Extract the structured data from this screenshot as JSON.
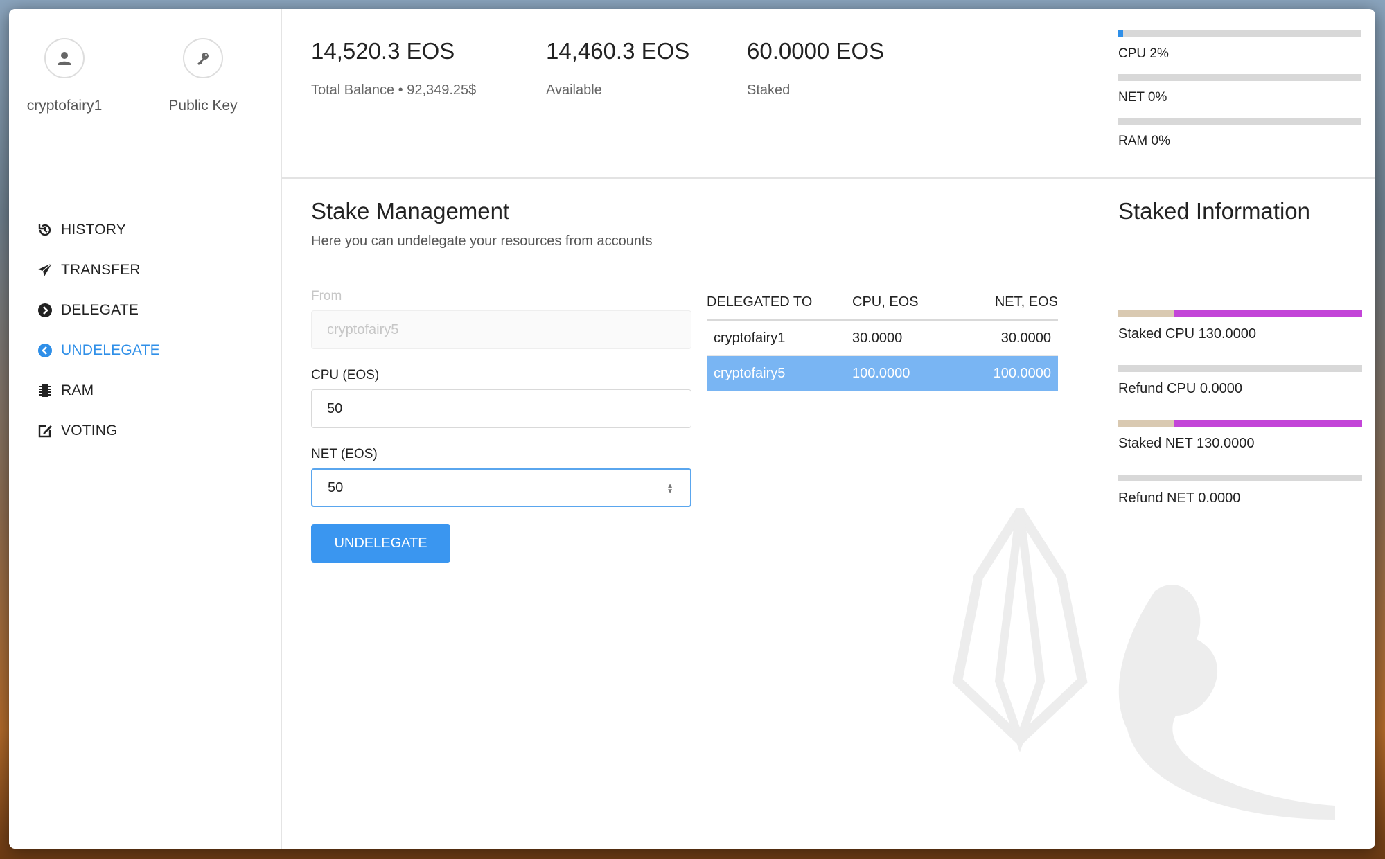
{
  "sidebar": {
    "account_name": "cryptofairy1",
    "public_key_label": "Public Key",
    "nav": [
      {
        "label": "HISTORY",
        "icon": "history-icon",
        "active": false
      },
      {
        "label": "TRANSFER",
        "icon": "paper-plane-icon",
        "active": false
      },
      {
        "label": "DELEGATE",
        "icon": "chevron-right-circle-icon",
        "active": false
      },
      {
        "label": "UNDELEGATE",
        "icon": "chevron-left-circle-icon",
        "active": true
      },
      {
        "label": "RAM",
        "icon": "chip-icon",
        "active": false
      },
      {
        "label": "VOTING",
        "icon": "edit-icon",
        "active": false
      }
    ]
  },
  "header": {
    "total_value": "14,520.3 EOS",
    "total_label": "Total Balance • 92,349.25$",
    "available_value": "14,460.3 EOS",
    "available_label": "Available",
    "staked_value": "60.0000 EOS",
    "staked_label": "Staked"
  },
  "resources": [
    {
      "label": "CPU 2%",
      "percent": 2
    },
    {
      "label": "NET 0%",
      "percent": 0
    },
    {
      "label": "RAM 0%",
      "percent": 0
    }
  ],
  "stake": {
    "title": "Stake Management",
    "subtitle": "Here you can undelegate your resources from accounts",
    "from_label": "From",
    "from_value": "cryptofairy5",
    "cpu_label": "CPU (EOS)",
    "cpu_value": "50",
    "net_label": "NET (EOS)",
    "net_value": "50",
    "button_label": "UNDELEGATE"
  },
  "table": {
    "headers": [
      "DELEGATED TO",
      "CPU, EOS",
      "NET, EOS"
    ],
    "rows": [
      {
        "account": "cryptofairy1",
        "cpu": "30.0000",
        "net": "30.0000",
        "selected": false
      },
      {
        "account": "cryptofairy5",
        "cpu": "100.0000",
        "net": "100.0000",
        "selected": true
      }
    ]
  },
  "staked_info": {
    "title": "Staked Information",
    "items": [
      {
        "label": "Staked CPU 130.0000",
        "self_fraction": 0.23,
        "delegated_fraction": 0.77
      },
      {
        "label": "Refund CPU 0.0000",
        "self_fraction": 0,
        "delegated_fraction": 0
      },
      {
        "label": "Staked NET 130.0000",
        "self_fraction": 0.23,
        "delegated_fraction": 0.77
      },
      {
        "label": "Refund NET 0.0000",
        "self_fraction": 0,
        "delegated_fraction": 0
      }
    ]
  },
  "colors": {
    "accent": "#2f8fe8",
    "button": "#3a96f0",
    "selected_row": "#79b5f3",
    "staked_self": "#d9c9b1",
    "staked_delegated": "#c345d8"
  }
}
